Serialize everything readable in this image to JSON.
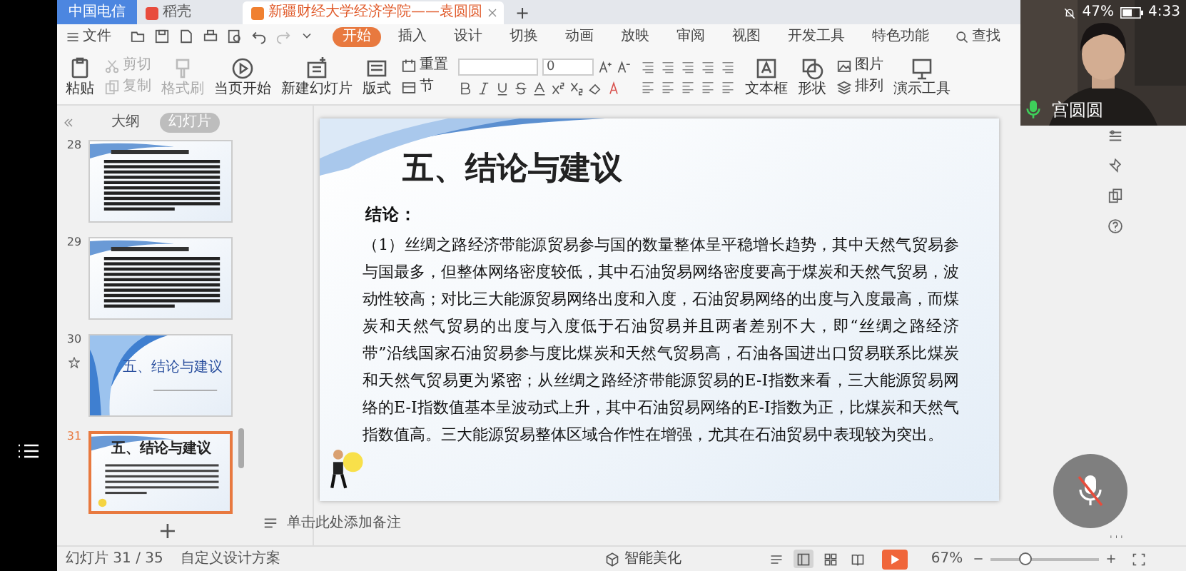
{
  "phone_status": {
    "carrier": "中国电信",
    "battery": "47%",
    "time": "4:33"
  },
  "browser_tabs": [
    {
      "label": "稻壳",
      "selected": false
    },
    {
      "label": "新疆财经大学经济学院——袁圆圆",
      "selected": true
    }
  ],
  "new_tab": "+",
  "menu": {
    "file": "文件",
    "tabs": [
      {
        "label": "开始",
        "selected": true
      },
      {
        "label": "插入",
        "selected": false
      },
      {
        "label": "设计",
        "selected": false
      },
      {
        "label": "切换",
        "selected": false
      },
      {
        "label": "动画",
        "selected": false
      },
      {
        "label": "放映",
        "selected": false
      },
      {
        "label": "审阅",
        "selected": false
      },
      {
        "label": "视图",
        "selected": false
      },
      {
        "label": "开发工具",
        "selected": false
      },
      {
        "label": "特色功能",
        "selected": false
      }
    ],
    "search": "查找"
  },
  "ribbon": [
    {
      "kind": "large",
      "label": "粘贴",
      "disabled": false
    },
    {
      "kind": "stack",
      "items": [
        {
          "label": "剪切",
          "disabled": true
        },
        {
          "label": "复制",
          "disabled": true
        }
      ]
    },
    {
      "kind": "large",
      "label": "格式刷",
      "disabled": true
    },
    {
      "kind": "large",
      "label": "当页开始",
      "disabled": false
    },
    {
      "kind": "large",
      "label": "新建幻灯片",
      "disabled": false
    },
    {
      "kind": "large",
      "label": "版式",
      "disabled": false
    },
    {
      "kind": "stack",
      "items": [
        {
          "label": "重置",
          "disabled": false
        },
        {
          "label": "节",
          "disabled": false
        }
      ]
    },
    {
      "kind": "font",
      "size": "0"
    },
    {
      "kind": "paragraph"
    },
    {
      "kind": "large",
      "label": "文本框",
      "disabled": false
    },
    {
      "kind": "large",
      "label": "形状",
      "disabled": false
    },
    {
      "kind": "stack",
      "items": [
        {
          "label": "图片",
          "disabled": false
        },
        {
          "label": "排列",
          "disabled": false
        }
      ]
    },
    {
      "kind": "large",
      "label": "演示工具",
      "disabled": false
    }
  ],
  "panel_tabs": [
    {
      "label": "大纲",
      "selected": false
    },
    {
      "label": "幻灯片",
      "selected": true
    }
  ],
  "thumbnails": [
    {
      "number": "28",
      "kind": "text",
      "selected": false,
      "animated": false
    },
    {
      "number": "29",
      "kind": "text",
      "selected": false,
      "animated": false
    },
    {
      "number": "30",
      "kind": "section",
      "title": "五、结论与建议",
      "selected": false,
      "animated": true
    },
    {
      "number": "31",
      "kind": "content",
      "title": "五、结论与建议",
      "selected": true,
      "animated": false
    }
  ],
  "add_slide": "+",
  "slide": {
    "title": "五、结论与建议",
    "heading": "结论：",
    "paragraph": "（1）丝绸之路经济带能源贸易参与国的数量整体呈平稳增长趋势，其中天然气贸易参与国最多，但整体网络密度较低，其中石油贸易网络密度要高于煤炭和天然气贸易，波动性较高；对比三大能源贸易网络出度和入度，石油贸易网络的出度与入度最高，而煤炭和天然气贸易的出度与入度低于石油贸易并且两者差别不大，即“丝绸之路经济带”沿线国家石油贸易参与度比煤炭和天然气贸易高，石油各国进出口贸易联系比煤炭和天然气贸易更为紧密；从丝绸之路经济带能源贸易的E-I指数来看，三大能源贸易网络的E-I指数值基本呈波动式上升，其中石油贸易网络的E-I指数为正，比煤炭和天然气指数值高。三大能源贸易整体区域合作性在增强，尤其在石油贸易中表现较为突出。"
  },
  "notes_placeholder": "单击此处添加备注",
  "status_bar": {
    "slide_count": "幻灯片 31 / 35",
    "design": "自定义设计方案",
    "beautify": "智能美化",
    "views": [
      {
        "selected": false
      },
      {
        "selected": true
      },
      {
        "selected": false
      },
      {
        "selected": false
      }
    ],
    "zoom": "67%",
    "zoom_slider": {
      "level": 0.32
    }
  },
  "video": {
    "name": "宫圆圆"
  }
}
